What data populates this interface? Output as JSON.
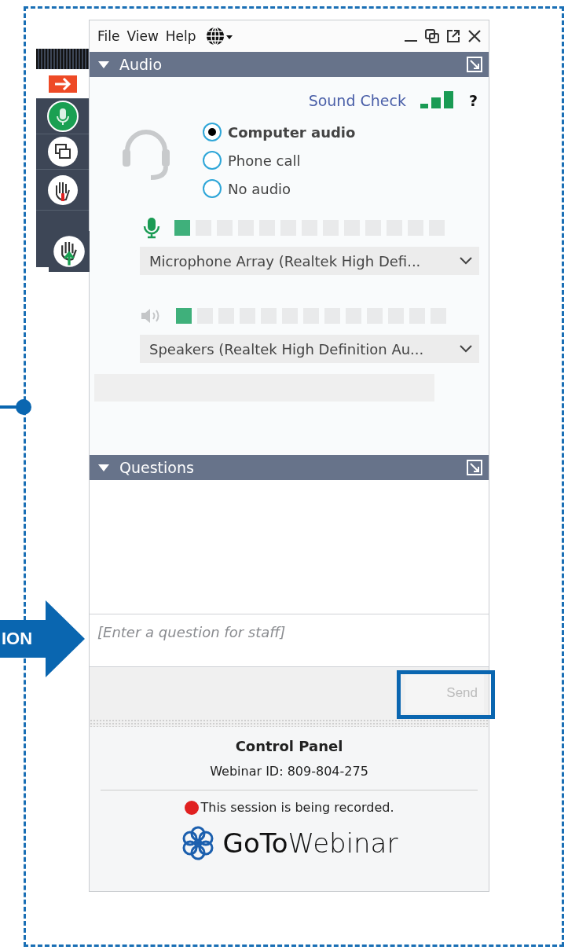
{
  "menu": [
    {
      "label": "File"
    },
    {
      "label": "View"
    },
    {
      "label": "Help"
    }
  ],
  "audio": {
    "title": "Audio",
    "expanded": true,
    "sound_check": "Sound Check",
    "help": "?",
    "options": [
      {
        "label": "Computer audio",
        "selected": true
      },
      {
        "label": "Phone call",
        "selected": false
      },
      {
        "label": "No audio",
        "selected": false
      }
    ],
    "microphone": {
      "level": 0.08,
      "device": "Microphone Array (Realtek High Defi..."
    },
    "speaker": {
      "level": 0.08,
      "device": "Speakers (Realtek High Definition Au..."
    }
  },
  "questions": {
    "title": "Questions",
    "expanded": true,
    "placeholder": "[Enter a question for staff]",
    "send": "Send",
    "send_disabled": true
  },
  "footer": {
    "title": "Control Panel",
    "webinar_id": "Webinar ID: 809-804-275",
    "recording": "This session is being recorded.",
    "logo": "**GoTo**Webinar"
  },
  "callout": {
    "label": "ION"
  }
}
